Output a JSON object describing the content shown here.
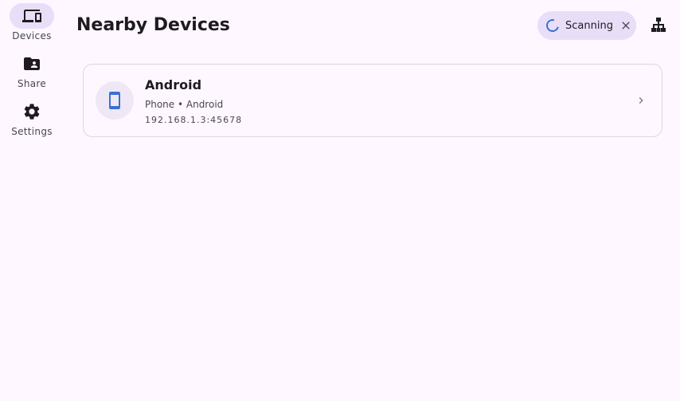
{
  "nav": {
    "items": [
      {
        "label": "Devices",
        "icon": "devices-icon",
        "active": true
      },
      {
        "label": "Share",
        "icon": "folder-shared-icon",
        "active": false
      },
      {
        "label": "Settings",
        "icon": "gear-icon",
        "active": false
      }
    ]
  },
  "header": {
    "title": "Nearby Devices",
    "scan_status": "Scanning",
    "network_icon": "network-icon"
  },
  "devices": [
    {
      "name": "Android",
      "meta": "Phone • Android",
      "address": "192.168.1.3:45678",
      "icon": "smartphone-icon"
    }
  ],
  "colors": {
    "background": "#fef7ff",
    "accent_container": "#e8def8",
    "device_icon": "#3b6fd4",
    "text_primary": "#1d1b20",
    "text_secondary": "#49454f"
  }
}
